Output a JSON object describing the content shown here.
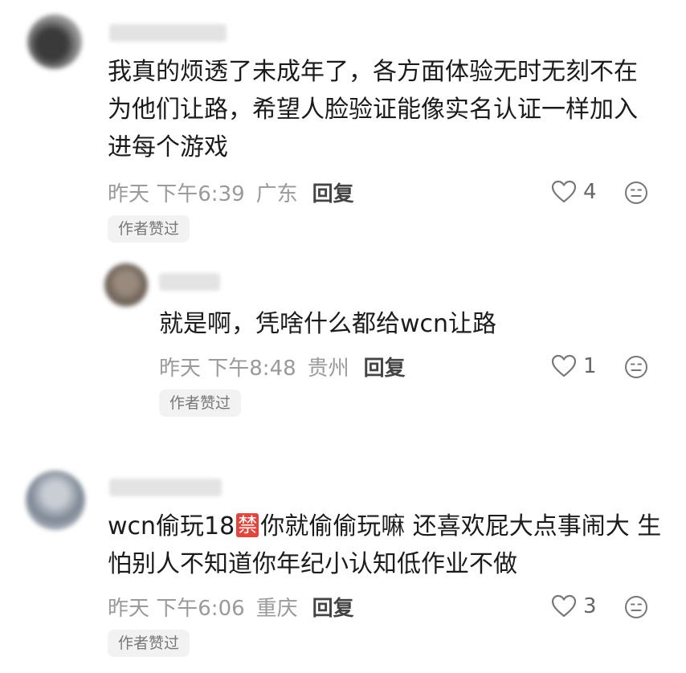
{
  "comments": [
    {
      "line1": "我真的烦透了未成年了，各方面体验无时无刻不在",
      "line2": "为他们让路，希望人脸验证能像实名认证一样加入",
      "line3": "进每个游戏",
      "time": "昨天 下午6:39",
      "location": "广东",
      "reply_label": "回复",
      "likes": "4",
      "badge": "作者赞过"
    },
    {
      "line1": "就是啊，凭啥什么都给wcn让路",
      "time": "昨天 下午8:48",
      "location": "贵州",
      "reply_label": "回复",
      "likes": "1",
      "badge": "作者赞过"
    },
    {
      "line1_prefix": "wcn偷玩18",
      "ban_char": "禁",
      "line1_suffix": "你就偷偷玩嘛 还喜欢屁大点事闹大 生",
      "line2": "怕别人不知道你年纪小认知低作业不做",
      "time": "昨天 下午6:06",
      "location": "重庆",
      "reply_label": "回复",
      "likes": "3",
      "badge": "作者赞过"
    }
  ],
  "icons": {
    "like": "heart-outline-icon",
    "dislike": "meh-face-icon"
  },
  "colors": {
    "ban_badge": "#e0463e",
    "meta_text": "#9a9a9a",
    "badge_bg": "#f2f2f2"
  }
}
